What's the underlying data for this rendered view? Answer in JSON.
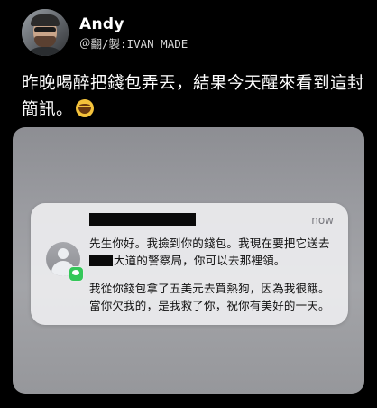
{
  "post": {
    "display_name": "Andy",
    "handle": "＠翻/製:IVAN MADE",
    "text": "昨晚喝醉把錢包弄丟，結果今天醒來看到這封簡訊。",
    "emoji": "joy-emoji"
  },
  "notification": {
    "time": "now",
    "message_part1_a": "先生你好。我撿到你的錢包。我現在要把它送去",
    "message_part1_b": "大道的警察局，你可以去那裡領。",
    "message_part2": "我從你錢包拿了五美元去買熱狗，因為我很餓。當你欠我的，是我救了你，祝你有美好的一天。",
    "app": "messages",
    "badge_color": "#34c759"
  }
}
